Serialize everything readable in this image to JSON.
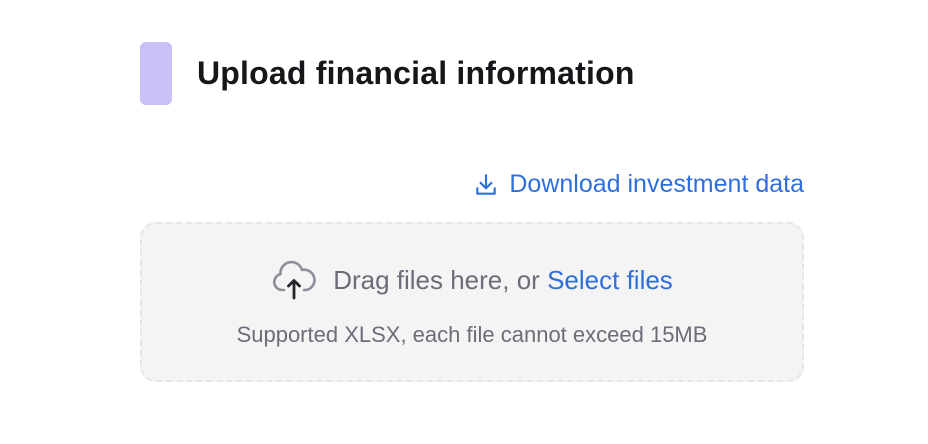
{
  "header": {
    "title": "Upload financial information",
    "accent_color": "#cbbff8"
  },
  "download": {
    "label": "Download investment data",
    "icon": "download-icon",
    "color": "#2f6fdc"
  },
  "dropzone": {
    "icon": "cloud-upload-icon",
    "prompt": "Drag files here, or",
    "select_label": "Select files",
    "hint": "Supported XLSX, each file cannot exceed 15MB"
  }
}
